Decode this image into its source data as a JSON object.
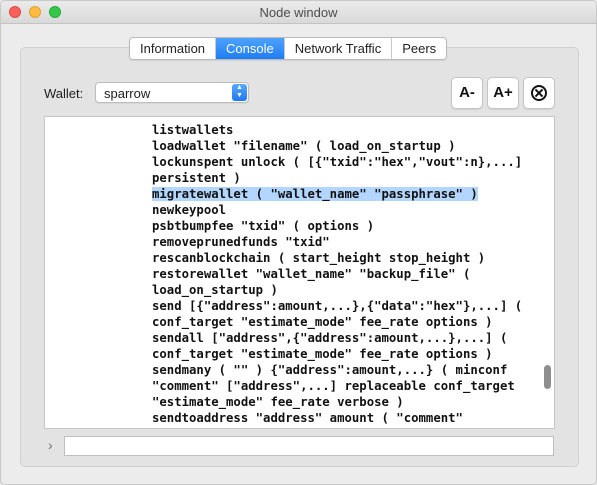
{
  "window": {
    "title": "Node window"
  },
  "tabs": [
    {
      "label": "Information",
      "active": false
    },
    {
      "label": "Console",
      "active": true
    },
    {
      "label": "Network Traffic",
      "active": false
    },
    {
      "label": "Peers",
      "active": false
    }
  ],
  "wallet": {
    "label": "Wallet:",
    "selected": "sparrow"
  },
  "toolbar": {
    "decrease_font_label": "A-",
    "increase_font_label": "A+",
    "clear_icon": "clear-circle-x-icon"
  },
  "console": {
    "lines": [
      "listwallets",
      "loadwallet \"filename\" ( load_on_startup )",
      "lockunspent unlock ( [{\"txid\":\"hex\",\"vout\":n},...]",
      "persistent )",
      "migratewallet ( \"wallet_name\" \"passphrase\" )",
      "newkeypool",
      "psbtbumpfee \"txid\" ( options )",
      "removeprunedfunds \"txid\"",
      "rescanblockchain ( start_height stop_height )",
      "restorewallet \"wallet_name\" \"backup_file\" (",
      "load_on_startup )",
      "send [{\"address\":amount,...},{\"data\":\"hex\"},...] (",
      "conf_target \"estimate_mode\" fee_rate options )",
      "sendall [\"address\",{\"address\":amount,...},...] (",
      "conf_target \"estimate_mode\" fee_rate options )",
      "sendmany ( \"\" ) {\"address\":amount,...} ( minconf",
      "\"comment\" [\"address\",...] replaceable conf_target",
      "\"estimate_mode\" fee_rate verbose )",
      "sendtoaddress \"address\" amount ( \"comment\""
    ],
    "highlighted_index": 4
  },
  "prompt": {
    "icon": "chevron-right-icon",
    "value": "",
    "placeholder": ""
  }
}
